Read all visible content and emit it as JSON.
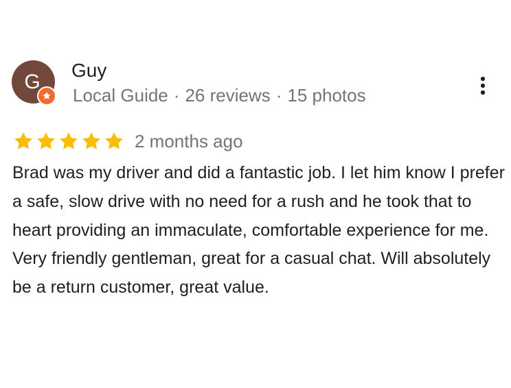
{
  "review": {
    "author": {
      "name": "Guy",
      "initial": "G",
      "avatar_color": "#73483c",
      "badge_icon": "star-icon",
      "badge_color": "#f26a2e",
      "status": "Local Guide",
      "reviews_count": "26 reviews",
      "photos_count": "15 photos",
      "separator": "·"
    },
    "menu_icon": "more-vertical-icon",
    "rating": {
      "stars": 5,
      "max_stars": 5,
      "star_color": "#fbbc04",
      "date": "2 months ago"
    },
    "text": "Brad was my driver and did a fantastic job. I let him know I prefer a safe, slow drive with no need for a rush and he took that to heart providing an immaculate, comfortable experience for me. Very friendly gentleman, great for a casual chat. Will absolutely be a return customer, great value."
  }
}
